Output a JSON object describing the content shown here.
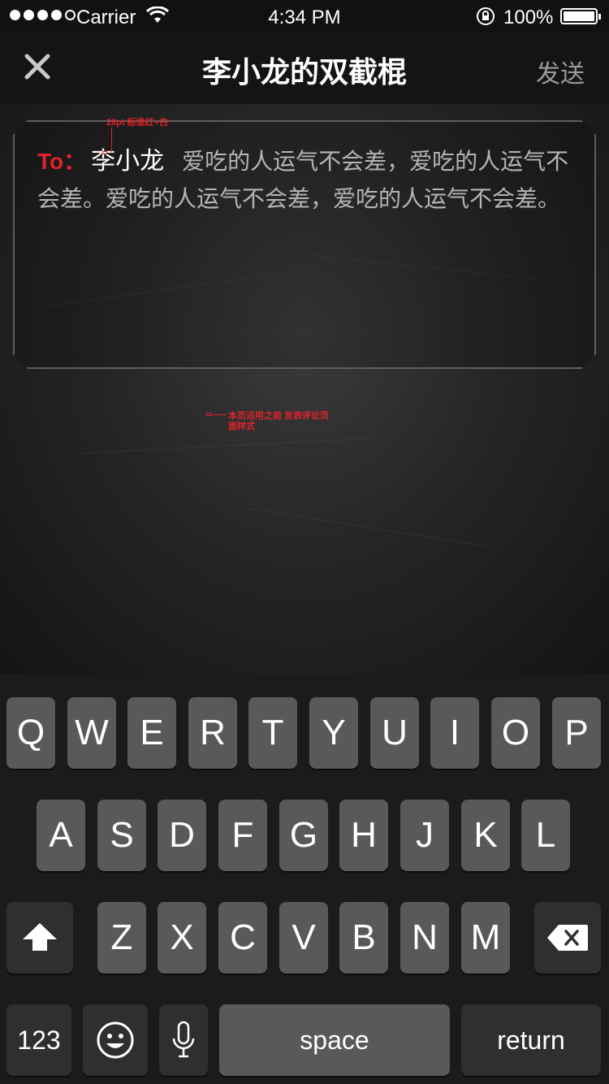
{
  "status_bar": {
    "carrier": "Carrier",
    "time": "4:34 PM",
    "battery": "100%"
  },
  "nav": {
    "close_icon": "close-icon",
    "title": "李小龙的双截棍",
    "send": "发送"
  },
  "composer": {
    "to_label": "To：",
    "recipient": "李小龙",
    "body": "爱吃的人运气不会差，爱吃的人运气不会差。爱吃的人运气不会差，爱吃的人运气不会差。"
  },
  "annotations": {
    "font_note": "28pt 标准红+白",
    "page_note_line1": "本页沿用之前 发表评论页",
    "page_note_line2": "面样式"
  },
  "keyboard": {
    "row1": [
      "Q",
      "W",
      "E",
      "R",
      "T",
      "Y",
      "U",
      "I",
      "O",
      "P"
    ],
    "row2": [
      "A",
      "S",
      "D",
      "F",
      "G",
      "H",
      "J",
      "K",
      "L"
    ],
    "row3": [
      "Z",
      "X",
      "C",
      "V",
      "B",
      "N",
      "M"
    ],
    "shift_icon": "shift-icon",
    "backspace_icon": "backspace-icon",
    "numbers": "123",
    "emoji_icon": "emoji-icon",
    "mic_icon": "microphone-icon",
    "space": "space",
    "return": "return"
  }
}
